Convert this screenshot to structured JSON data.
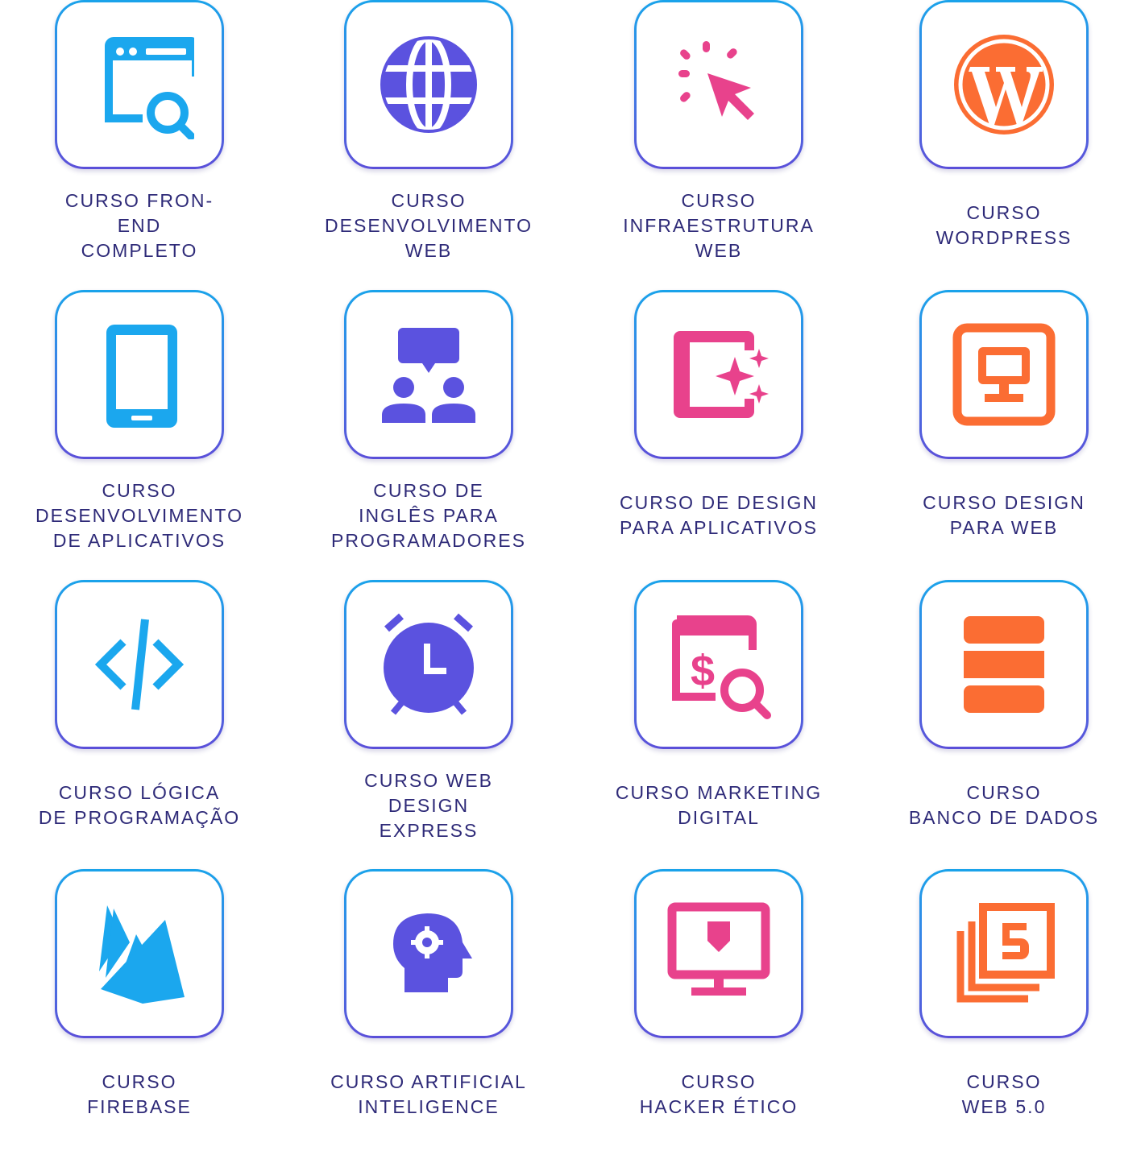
{
  "courses": [
    {
      "label": "CURSO FRON-\nEND\nCOMPLETO",
      "icon": "browser-search-icon"
    },
    {
      "label": "CURSO\nDESENVOLVIMENTO\nWEB",
      "icon": "globe-icon"
    },
    {
      "label": "CURSO\nINFRAESTRUTURA\nWEB",
      "icon": "cursor-click-icon"
    },
    {
      "label": "CURSO\nWORDPRESS",
      "icon": "wordpress-icon"
    },
    {
      "label": "CURSO\nDESENVOLVIMENTO\nDE APLICATIVOS",
      "icon": "smartphone-icon"
    },
    {
      "label": "CURSO DE\nINGLÊS PARA\nPROGRAMADORES",
      "icon": "people-chat-icon"
    },
    {
      "label": "CURSO DE DESIGN\nPARA APLICATIVOS",
      "icon": "app-design-sparkle-icon"
    },
    {
      "label": "CURSO DESIGN\nPARA WEB",
      "icon": "monitor-frame-icon"
    },
    {
      "label": "CURSO LÓGICA\nDE PROGRAMAÇÃO",
      "icon": "code-icon"
    },
    {
      "label": "CURSO WEB\nDESIGN\nEXPRESS",
      "icon": "alarm-clock-icon"
    },
    {
      "label": "CURSO MARKETING\nDIGITAL",
      "icon": "dollar-search-icon"
    },
    {
      "label": "CURSO\nBANCO DE DADOS",
      "icon": "database-icon"
    },
    {
      "label": "CURSO\nFIREBASE",
      "icon": "firebase-icon"
    },
    {
      "label": "CURSO ARTIFICIAL\nINTELIGENCE",
      "icon": "head-gear-icon"
    },
    {
      "label": "CURSO\nHACKER ÉTICO",
      "icon": "monitor-shield-icon"
    },
    {
      "label": "CURSO\nWEB 5.0",
      "icon": "html5-icon"
    }
  ],
  "colors": {
    "blue": "#1ba7ee",
    "purple": "#5b52df",
    "pink": "#e8428c",
    "orange": "#fb6d33",
    "text": "#2e2a78"
  }
}
